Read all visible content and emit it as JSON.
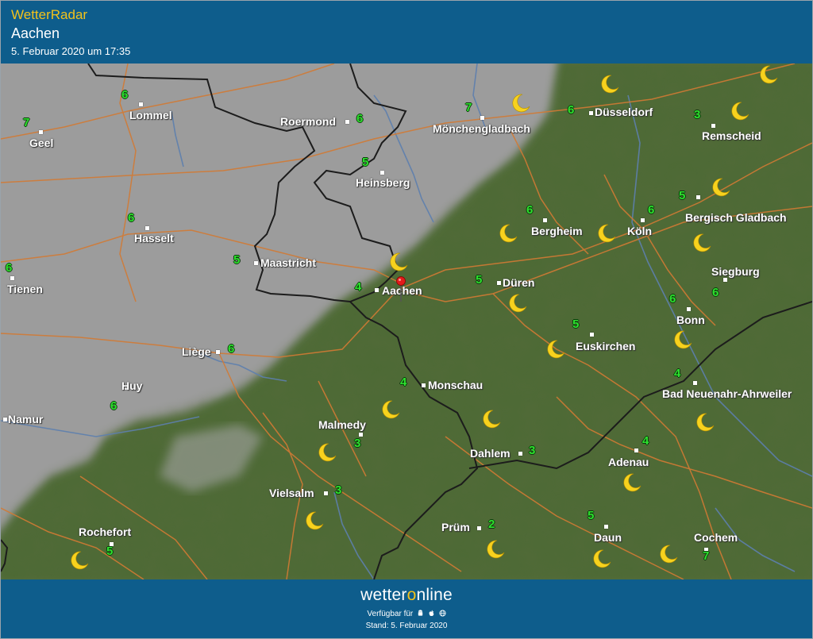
{
  "header": {
    "app_title": "WetterRadar",
    "location": "Aachen",
    "datetime": "5. Februar 2020 um 17:35"
  },
  "map": {
    "selected_location": "Aachen",
    "night_icon": "crescent-moon-icon",
    "marker_icon": "location-pin-icon",
    "colors": {
      "terrain": "#4d6b34",
      "no_data": "#9a9a9a",
      "roads": "#d27a34",
      "borders": "#1c1c1c",
      "rivers": "#5d7fae",
      "temperature_text": "#2ee02e",
      "moon": "#f7d21e",
      "marker": "#e21b1b"
    },
    "cities": [
      {
        "name": "Lommel",
        "temp": "6"
      },
      {
        "name": "Geel",
        "temp": "7"
      },
      {
        "name": "Roermond",
        "temp": "6"
      },
      {
        "name": "Mönchengladbach",
        "temp": "7"
      },
      {
        "name": "Düsseldorf",
        "temp": "6"
      },
      {
        "name": "Remscheid",
        "temp": "3"
      },
      {
        "name": "Heinsberg",
        "temp": "5"
      },
      {
        "name": "Hasselt",
        "temp": "6"
      },
      {
        "name": "Bergheim",
        "temp": "6"
      },
      {
        "name": "Köln",
        "temp": "6"
      },
      {
        "name": "Bergisch Gladbach",
        "temp": "5"
      },
      {
        "name": "Maastricht",
        "temp": "5"
      },
      {
        "name": "Tienen",
        "temp": "6"
      },
      {
        "name": "Aachen",
        "temp": "4"
      },
      {
        "name": "Düren",
        "temp": "5"
      },
      {
        "name": "Siegburg",
        "temp": "6"
      },
      {
        "name": "Bonn",
        "temp": "6"
      },
      {
        "name": "Liège",
        "temp": "6"
      },
      {
        "name": "Euskirchen",
        "temp": "5"
      },
      {
        "name": "Huy",
        "temp": "6"
      },
      {
        "name": "Monschau",
        "temp": "4"
      },
      {
        "name": "Bad Neuenahr-Ahrweiler",
        "temp": "4"
      },
      {
        "name": "Namur",
        "temp": ""
      },
      {
        "name": "Malmedy",
        "temp": "3"
      },
      {
        "name": "Dahlem",
        "temp": "3"
      },
      {
        "name": "Adenau",
        "temp": "4"
      },
      {
        "name": "Vielsalm",
        "temp": "3"
      },
      {
        "name": "Prüm",
        "temp": "2"
      },
      {
        "name": "Daun",
        "temp": "5"
      },
      {
        "name": "Rochefort",
        "temp": "5"
      },
      {
        "name": "Cochem",
        "temp": "7"
      }
    ]
  },
  "footer": {
    "brand_prefix": "wetter",
    "brand_o": "o",
    "brand_suffix": "nline",
    "available_label": "Verfügbar für",
    "platform_icons": [
      "android-icon",
      "apple-icon",
      "web-icon"
    ],
    "stand_label": "Stand: 5. Februar 2020"
  }
}
